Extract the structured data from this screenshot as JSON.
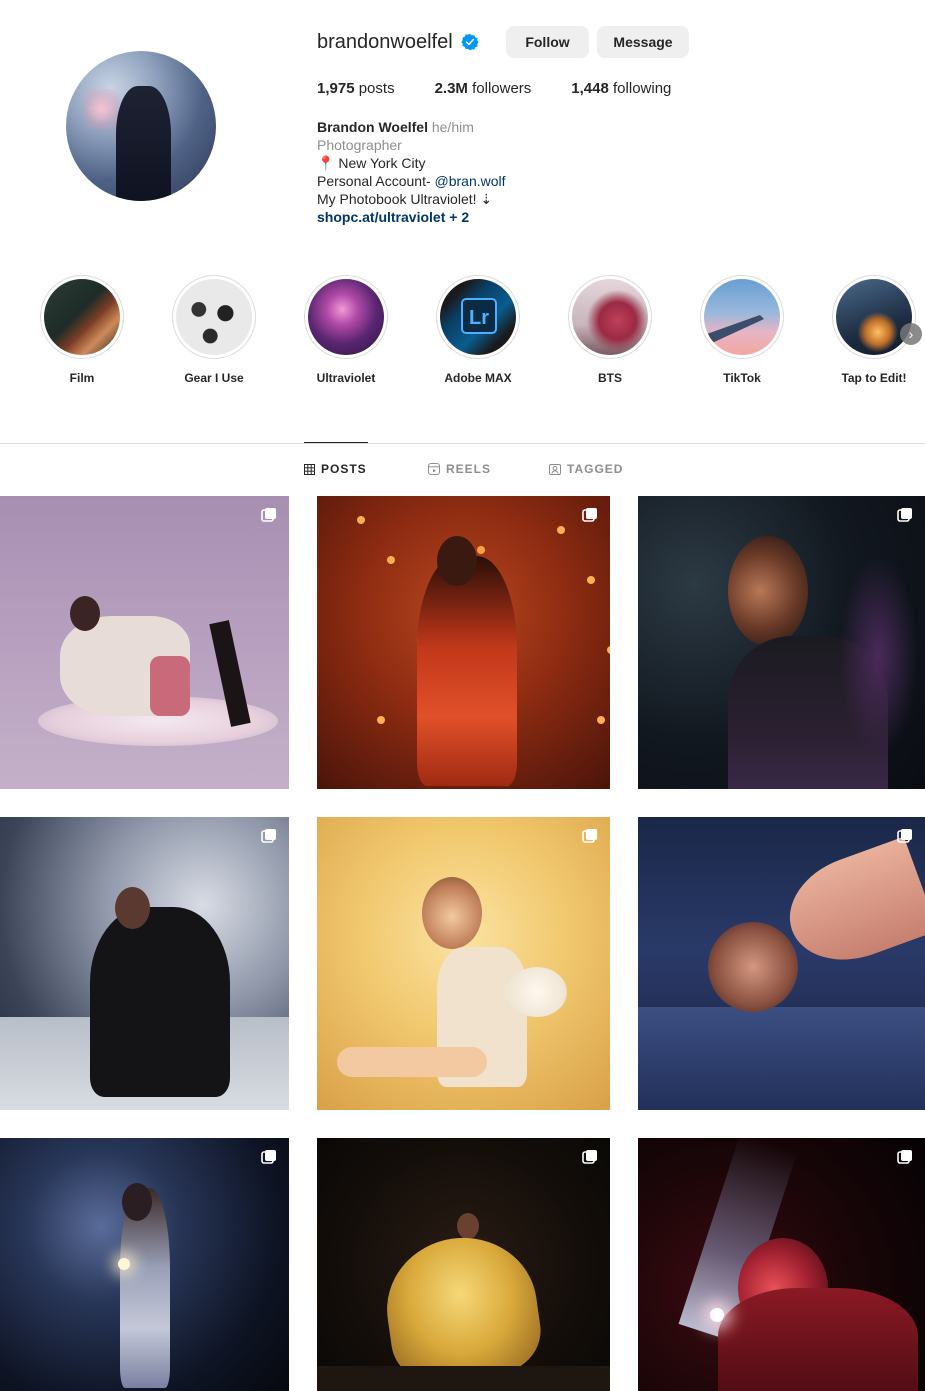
{
  "profile": {
    "username": "brandonwoelfel",
    "follow_label": "Follow",
    "message_label": "Message",
    "stats": {
      "posts_count": "1,975",
      "posts_label": "posts",
      "followers_count": "2.3M",
      "followers_label": "followers",
      "following_count": "1,448",
      "following_label": "following"
    },
    "bio": {
      "name": "Brandon Woelfel",
      "pronouns": "he/him",
      "category": "Photographer",
      "location_pin": "📍",
      "location": "New York City",
      "personal_prefix": "Personal Account-",
      "personal_handle": "@bran.wolf",
      "photobook_text": "My Photobook Ultraviolet! ⇣",
      "link": "shopc.at/ultraviolet + 2"
    }
  },
  "highlights": [
    {
      "label": "Film"
    },
    {
      "label": "Gear I Use"
    },
    {
      "label": "Ultraviolet"
    },
    {
      "label": "Adobe MAX"
    },
    {
      "label": "BTS"
    },
    {
      "label": "TikTok"
    },
    {
      "label": "Tap to Edit!"
    }
  ],
  "tabs": [
    {
      "label": "POSTS",
      "active": true,
      "icon": "grid-icon"
    },
    {
      "label": "REELS",
      "active": false,
      "icon": "reels-icon"
    },
    {
      "label": "TAGGED",
      "active": false,
      "icon": "tagged-icon"
    }
  ],
  "colors": {
    "button_bg": "#efefef",
    "verified_blue": "#0095f6",
    "link_blue": "#00376b",
    "muted": "#8e8e8e"
  }
}
